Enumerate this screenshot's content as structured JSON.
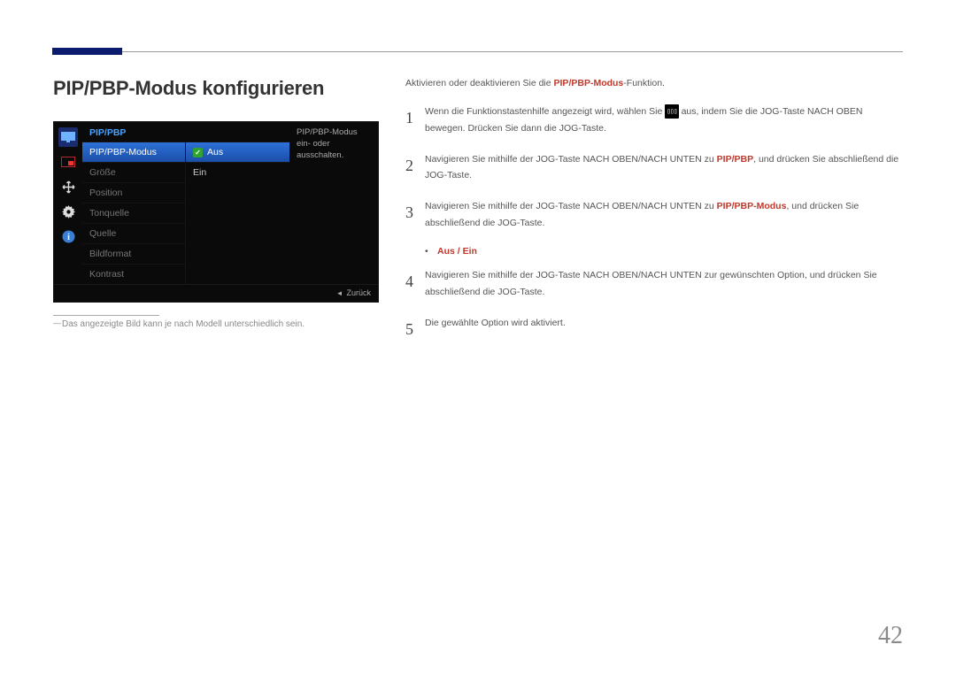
{
  "page_number": "42",
  "heading": "PIP/PBP-Modus konfigurieren",
  "osd": {
    "title": "PIP/PBP",
    "tooltip": "PIP/PBP-Modus ein- oder ausschalten.",
    "menu_items": [
      "PIP/PBP-Modus",
      "Größe",
      "Position",
      "Tonquelle",
      "Quelle",
      "Bildformat",
      "Kontrast"
    ],
    "options": [
      "Aus",
      "Ein"
    ],
    "back_label": "Zurück"
  },
  "footnote": "Das angezeigte Bild kann je nach Modell unterschiedlich sein.",
  "intro_pre": "Aktivieren oder deaktivieren Sie die ",
  "intro_hl": "PIP/PBP-Modus",
  "intro_post": "-Funktion.",
  "steps": {
    "s1a": "Wenn die Funktionstastenhilfe angezeigt wird, wählen Sie ",
    "s1b": " aus, indem Sie die JOG-Taste NACH OBEN bewegen. Drücken Sie dann die JOG-Taste.",
    "s2a": "Navigieren Sie mithilfe der JOG-Taste NACH OBEN/NACH UNTEN zu ",
    "s2hl": "PIP/PBP",
    "s2b": ", und drücken Sie abschließend die JOG-Taste.",
    "s3a": "Navigieren Sie mithilfe der JOG-Taste NACH OBEN/NACH UNTEN zu ",
    "s3hl": "PIP/PBP-Modus",
    "s3b": ", und drücken Sie abschließend die JOG-Taste.",
    "s4": "Navigieren Sie mithilfe der JOG-Taste NACH OBEN/NACH UNTEN zur gewünschten Option, und drücken Sie abschließend die JOG-Taste.",
    "s5": "Die gewählte Option wird aktiviert."
  },
  "bullet": "Aus / Ein"
}
